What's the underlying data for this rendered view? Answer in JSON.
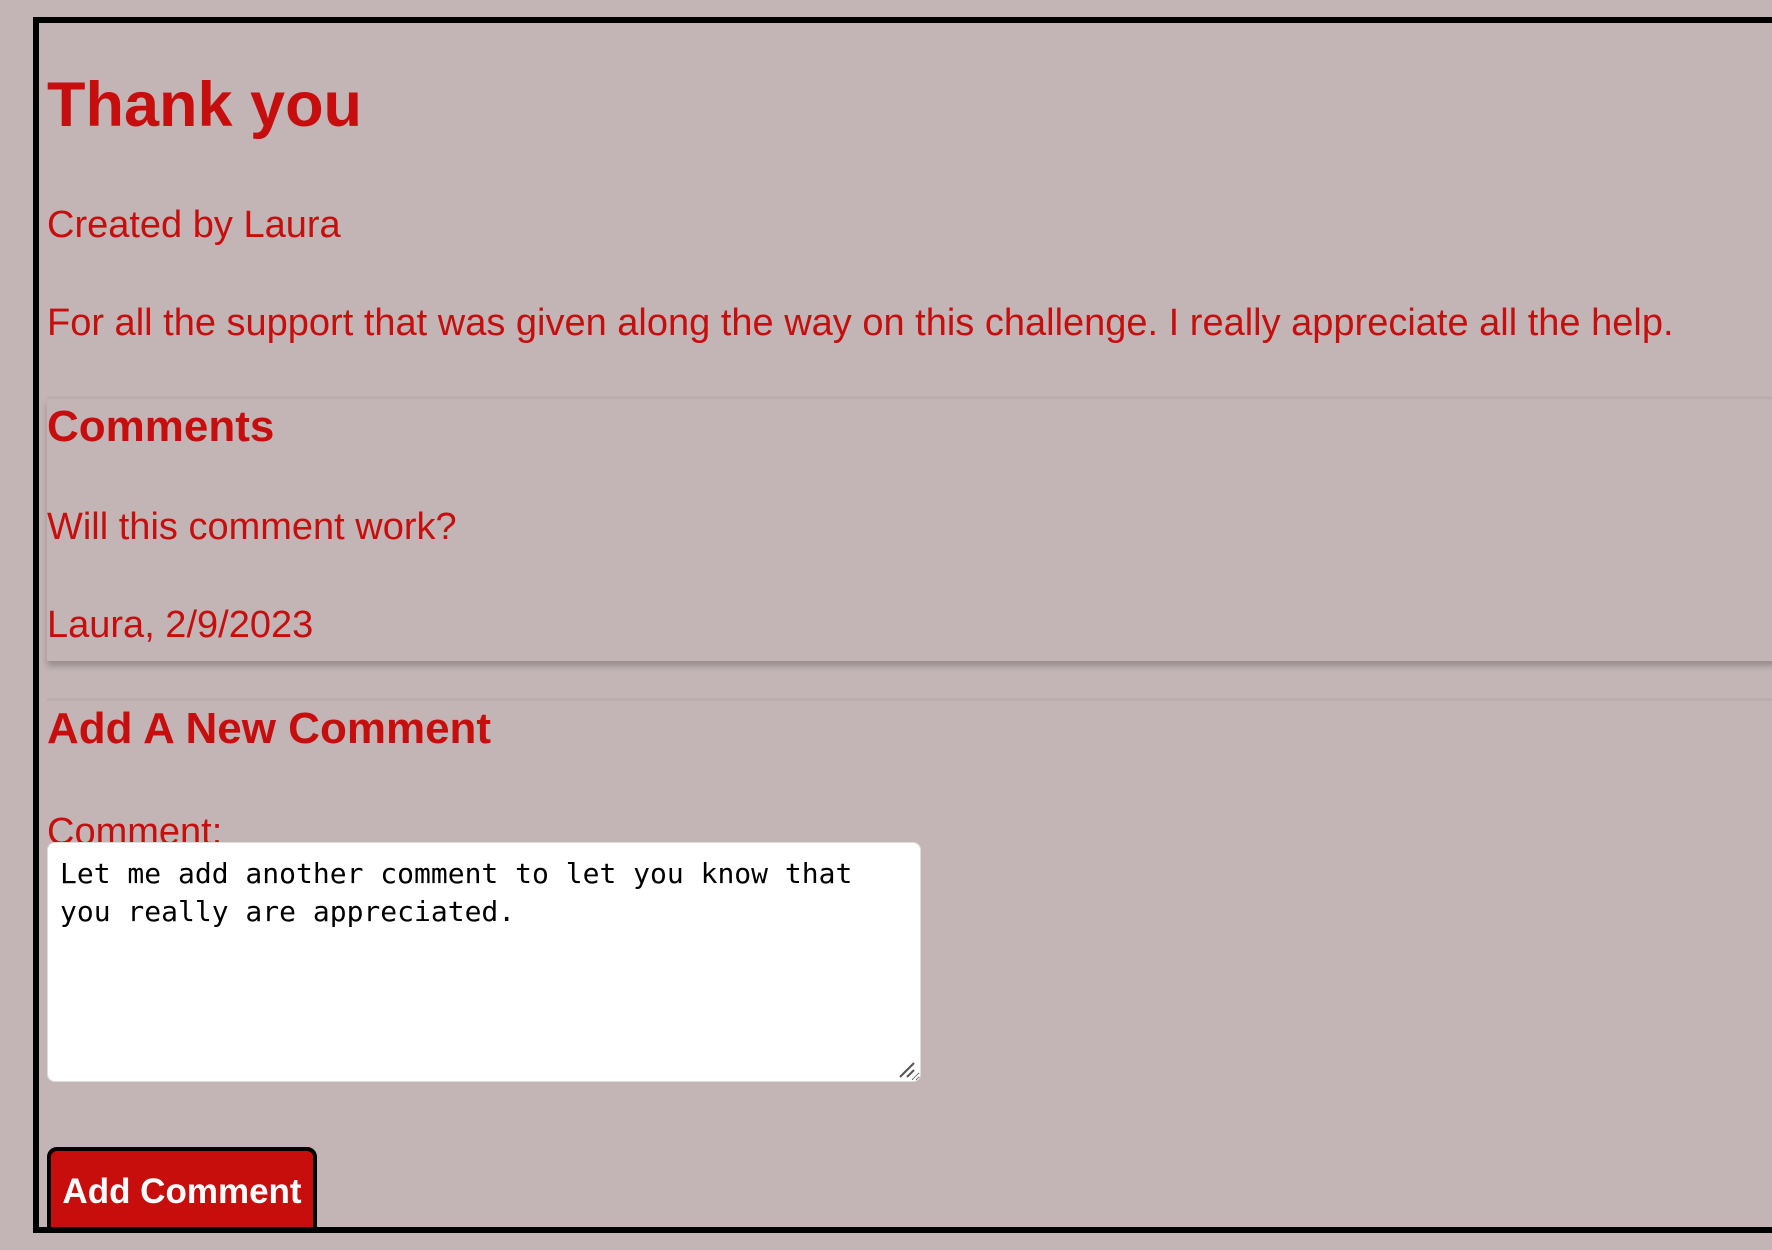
{
  "post": {
    "title": "Thank you",
    "author_line": "Created by Laura",
    "description": "For all the support that was given along the way on this challenge. I really appreciate all the help."
  },
  "comments": {
    "heading": "Comments",
    "items": [
      {
        "text": "Will this comment work?",
        "meta": "Laura, 2/9/2023"
      }
    ]
  },
  "new_comment": {
    "heading": "Add A New Comment",
    "label": "Comment:",
    "value": "Let me add another comment to let you know that you really are appreciated.",
    "submit_label": "Add Comment"
  },
  "colors": {
    "page_background": "#c3b5b5",
    "text_red": "#c70e0e",
    "button_red": "#c80d0d",
    "border": "#000000"
  },
  "icons": {
    "resize": "resize-grip-icon"
  }
}
